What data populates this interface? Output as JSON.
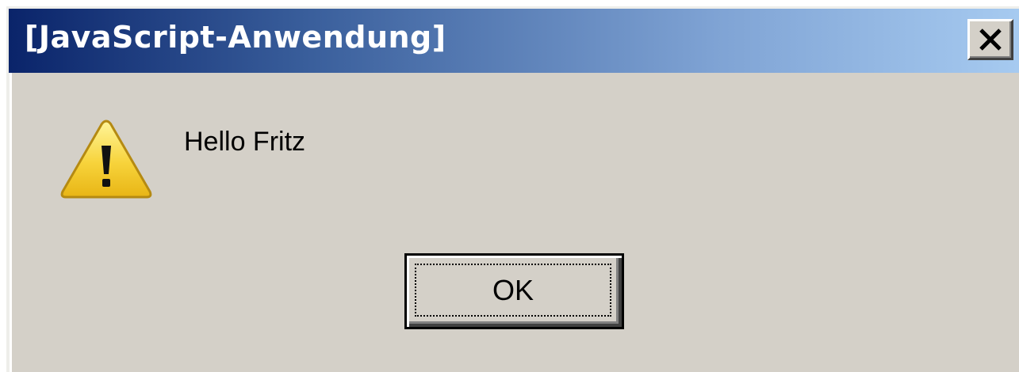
{
  "window": {
    "title": "[JavaScript-Anwendung]",
    "close_icon": "close-icon"
  },
  "content": {
    "icon": "warning-icon",
    "message": "Hello Fritz"
  },
  "buttons": {
    "ok_label": "OK"
  },
  "colors": {
    "dialog_background": "#d4d0c8",
    "titlebar_start": "#0a246a",
    "titlebar_end": "#a6caf0",
    "title_text": "#ffffff",
    "warning_fill": "#f7d33b"
  }
}
